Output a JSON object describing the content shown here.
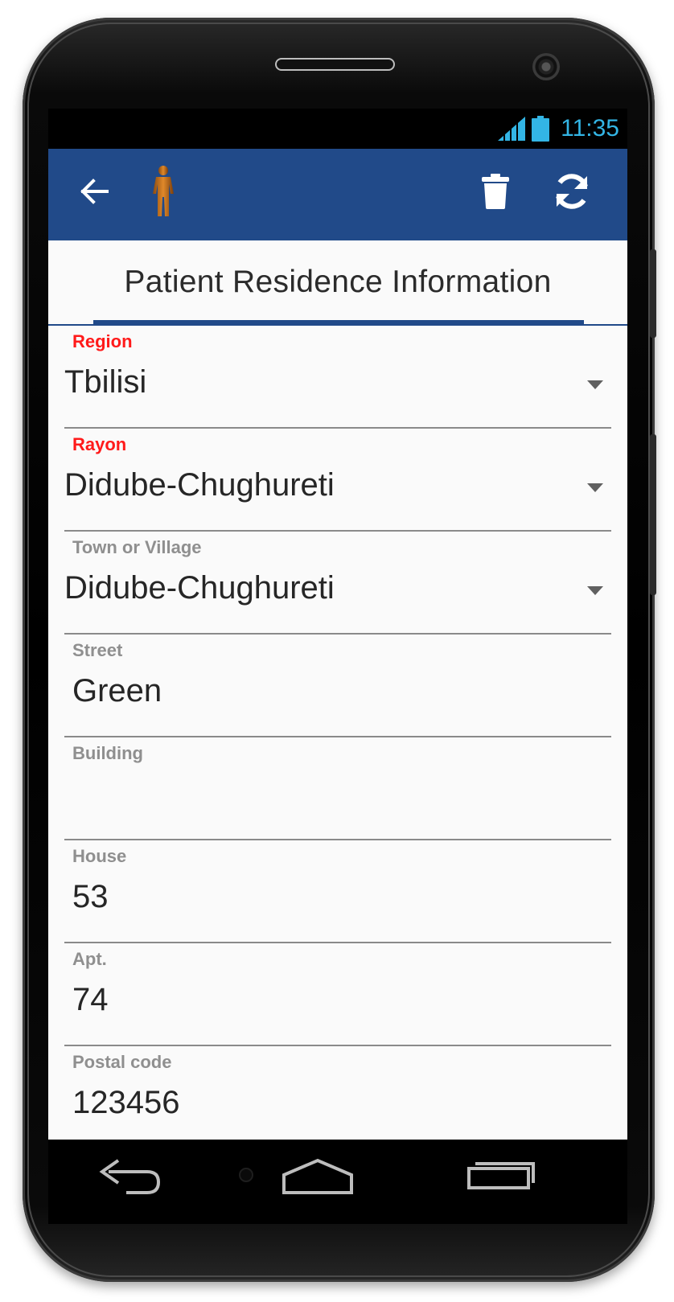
{
  "status": {
    "time": "11:35"
  },
  "appbar": {
    "back_icon": "arrow-left-icon",
    "person_icon": "person-figure-icon",
    "delete_icon": "trash-icon",
    "sync_icon": "sync-icon"
  },
  "tab": {
    "title": "Patient Residence Information"
  },
  "fields": [
    {
      "label": "Region",
      "value": "Tbilisi",
      "required": true,
      "dropdown": true
    },
    {
      "label": "Rayon",
      "value": "Didube-Chughureti",
      "required": true,
      "dropdown": true
    },
    {
      "label": "Town or Village",
      "value": "Didube-Chughureti",
      "required": false,
      "dropdown": true
    },
    {
      "label": "Street",
      "value": "Green",
      "required": false,
      "dropdown": false
    },
    {
      "label": "Building",
      "value": "",
      "required": false,
      "dropdown": false
    },
    {
      "label": "House",
      "value": "53",
      "required": false,
      "dropdown": false
    },
    {
      "label": "Apt.",
      "value": "74",
      "required": false,
      "dropdown": false
    },
    {
      "label": "Postal code",
      "value": "123456",
      "required": false,
      "dropdown": false
    }
  ],
  "navbar": {
    "back_icon": "nav-back-icon",
    "home_icon": "nav-home-icon",
    "recents_icon": "nav-recents-icon"
  },
  "colors": {
    "appbar": "#214a89",
    "required_label": "#ff1a1a",
    "status_accent": "#33b5e5"
  }
}
